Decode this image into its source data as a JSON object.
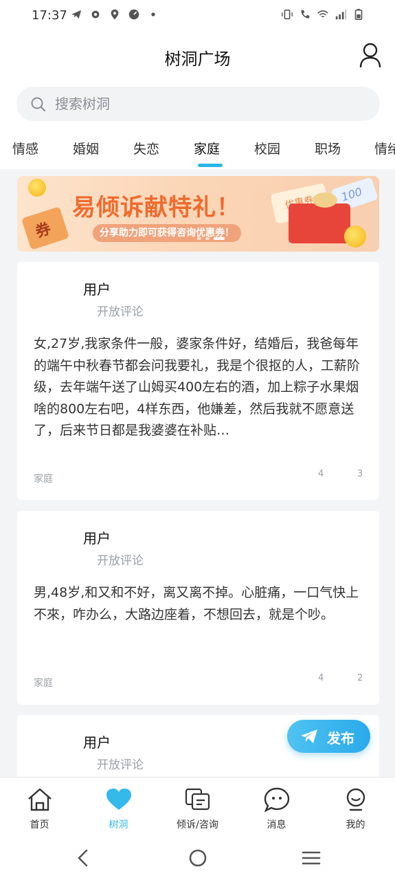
{
  "status_bar": {
    "time": "17:37"
  },
  "header": {
    "title": "树洞广场"
  },
  "search": {
    "placeholder": "搜索树洞"
  },
  "tabs": [
    {
      "label": "情感"
    },
    {
      "label": "婚姻"
    },
    {
      "label": "失恋"
    },
    {
      "label": "家庭"
    },
    {
      "label": "校园"
    },
    {
      "label": "职场"
    },
    {
      "label": "情绪"
    }
  ],
  "active_tab": "家庭",
  "banner": {
    "title": "易倾诉献特礼！",
    "subtitle": "分享助力即可获得咨询优惠券！",
    "coupon_left": "券",
    "coupon_ticket": "优惠券",
    "coupon_value": "100"
  },
  "posts": [
    {
      "user": "用户",
      "comment_status": "开放评论",
      "content": "女,27岁,我家条件一般，婆家条件好，结婚后，我爸每年的端午中秋春节都会问我要礼，我是个很抠的人，工薪阶级，去年端午送了山姆买400左右的酒，加上粽子水果烟啥的800左右吧，4样东西，他嫌差，然后我就不愿意送了，后来节日都是我婆婆在补贴…",
      "tag": "家庭",
      "stat1": "4",
      "stat2": "3"
    },
    {
      "user": "用户",
      "comment_status": "开放评论",
      "content": "男,48岁,和又和不好，离又离不掉。心脏痛，一口气快上不來，咋办么，大路边座着，不想回去，就是个吵。",
      "tag": "家庭",
      "stat1": "4",
      "stat2": "2"
    },
    {
      "user": "用户",
      "comment_status": "开放评论"
    }
  ],
  "publish_button": {
    "label": "发布"
  },
  "tabbar": [
    {
      "label": "首页",
      "icon": "home-icon"
    },
    {
      "label": "树洞",
      "icon": "heart-icon"
    },
    {
      "label": "倾诉/咨询",
      "icon": "chat-card-icon"
    },
    {
      "label": "消息",
      "icon": "message-bubble-icon"
    },
    {
      "label": "我的",
      "icon": "smile-face-icon"
    }
  ],
  "colors": {
    "accent": "#35b8ea",
    "banner_orange": "#ef6b2e"
  }
}
